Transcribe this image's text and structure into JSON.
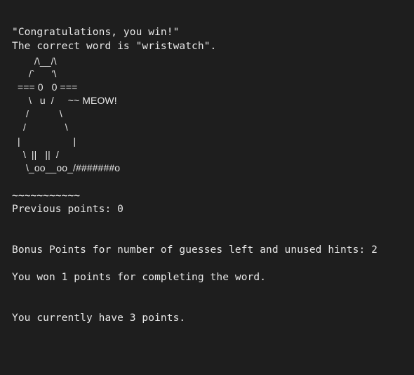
{
  "terminal": {
    "congrats": "\"Congratulations, you win!\"",
    "correct_word": "The correct word is \"wristwatch\".",
    "cat_art": [
      "        /\\__/\\",
      "      /`      '\\",
      "  === 0   0 ===",
      "      \\   u  /     ~~ MEOW!",
      "     /           \\",
      "    /              \\",
      "  |                   |",
      "    \\  ||   ||  /",
      "     \\_oo__oo_/#######o"
    ],
    "tilde_line": "~~~~~~~~~~~",
    "previous_points": "Previous points: 0",
    "bonus_points": "Bonus Points for number of guesses left and unused hints: 2",
    "won_points": "You won 1 points for completing the word.",
    "current_points": "You currently have 3 points."
  }
}
